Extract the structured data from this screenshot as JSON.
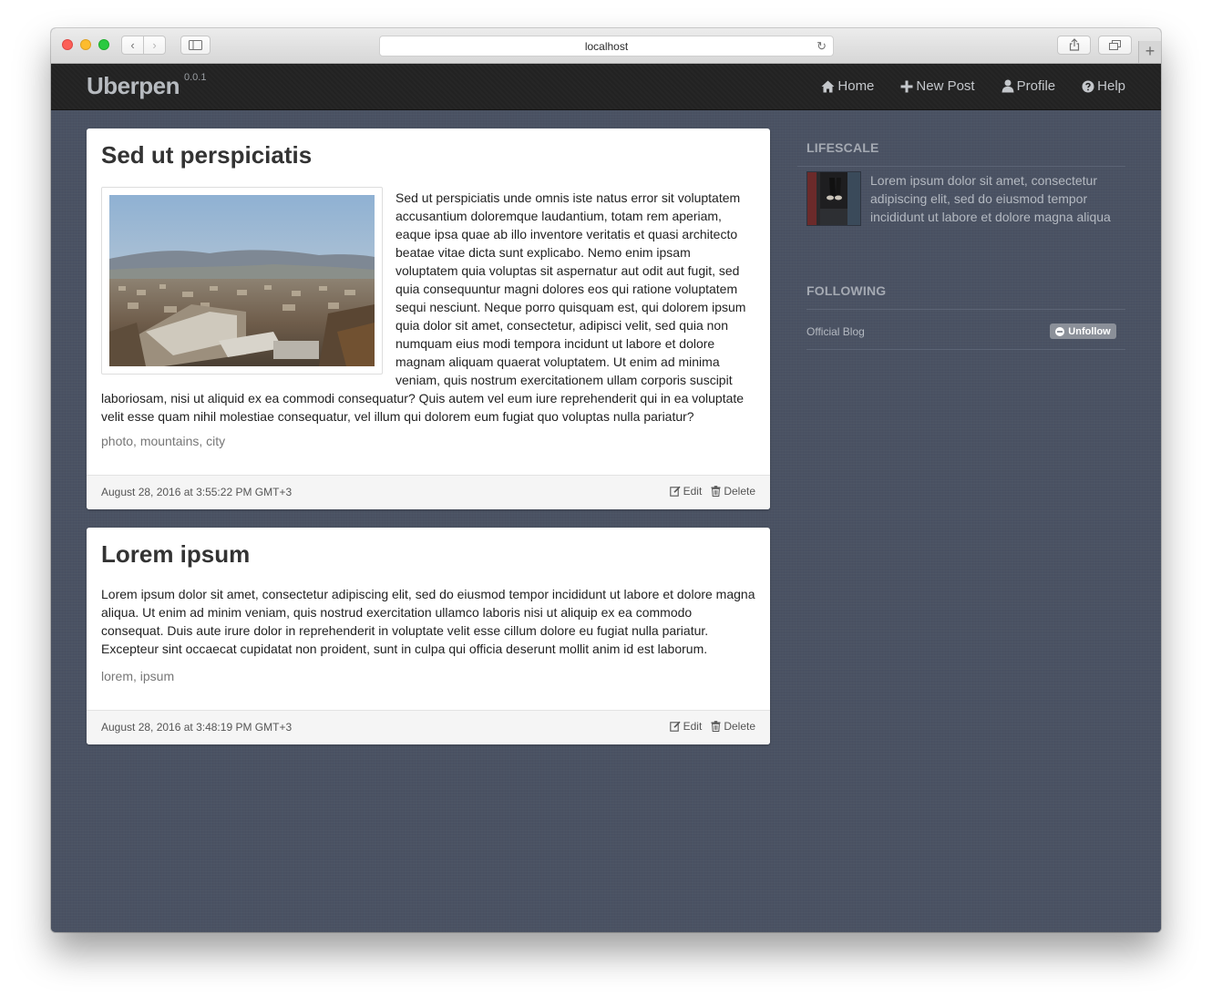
{
  "browser": {
    "url": "localhost"
  },
  "app": {
    "brand": "Uberpen",
    "version": "0.0.1",
    "nav": [
      {
        "label": "Home",
        "icon": "home-icon"
      },
      {
        "label": "New Post",
        "icon": "plus-icon"
      },
      {
        "label": "Profile",
        "icon": "user-icon"
      },
      {
        "label": "Help",
        "icon": "question-icon"
      }
    ]
  },
  "posts": [
    {
      "title": "Sed ut perspiciatis",
      "image": "city-landscape-photo",
      "body": "Sed ut perspiciatis unde omnis iste natus error sit voluptatem accusantium doloremque laudantium, totam rem aperiam, eaque ipsa quae ab illo inventore veritatis et quasi architecto beatae vitae dicta sunt explicabo. Nemo enim ipsam voluptatem quia voluptas sit aspernatur aut odit aut fugit, sed quia consequuntur magni dolores eos qui ratione voluptatem sequi nesciunt. Neque porro quisquam est, qui dolorem ipsum quia dolor sit amet, consectetur, adipisci velit, sed quia non numquam eius modi tempora incidunt ut labore et dolore magnam aliquam quaerat voluptatem. Ut enim ad minima veniam, quis nostrum exercitationem ullam corporis suscipit laboriosam, nisi ut aliquid ex ea commodi consequatur? Quis autem vel eum iure reprehenderit qui in ea voluptate velit esse quam nihil molestiae consequatur, vel illum qui dolorem eum fugiat quo voluptas nulla pariatur?",
      "tags": "photo, mountains, city",
      "timestamp": "August 28, 2016 at 3:55:22 PM GMT+3",
      "edit_label": "Edit",
      "delete_label": "Delete"
    },
    {
      "title": "Lorem ipsum",
      "body": "Lorem ipsum dolor sit amet, consectetur adipiscing elit, sed do eiusmod tempor incididunt ut labore et dolore magna aliqua. Ut enim ad minim veniam, quis nostrud exercitation ullamco laboris nisi ut aliquip ex ea commodo consequat. Duis aute irure dolor in reprehenderit in voluptate velit esse cillum dolore eu fugiat nulla pariatur. Excepteur sint occaecat cupidatat non proident, sunt in culpa qui officia deserunt mollit anim id est laborum.",
      "tags": "lorem, ipsum",
      "timestamp": "August 28, 2016 at 3:48:19 PM GMT+3",
      "edit_label": "Edit",
      "delete_label": "Delete"
    }
  ],
  "sidebar": {
    "lifescale": {
      "heading": "LIFESCALE",
      "text": "Lorem ipsum dolor sit amet, consectetur adipiscing elit, sed do eiusmod tempor incididunt ut labore et dolore magna aliqua"
    },
    "following": {
      "heading": "FOLLOWING",
      "items": [
        {
          "name": "Official Blog",
          "button": "Unfollow"
        }
      ]
    }
  },
  "colors": {
    "background": "#4a5263",
    "navbar": "#222222",
    "card": "#ffffff"
  }
}
